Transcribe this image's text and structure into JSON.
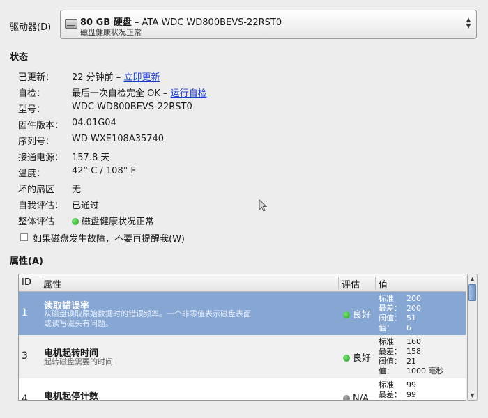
{
  "drive": {
    "label": "驱动器(D)",
    "size": "80 GB 硬盘",
    "model_suffix": " – ATA WDC WD800BEVS-22RST0",
    "subtitle": "磁盘健康状况正常"
  },
  "status": {
    "title": "状态",
    "rows": [
      {
        "key": "已更新：",
        "value": "22 分钟前 – ",
        "link": "立即更新"
      },
      {
        "key": "自检：",
        "value": "最后一次自检完全 OK – ",
        "link": "运行自检"
      },
      {
        "key": "型号：",
        "value": "WDC WD800BEVS-22RST0"
      },
      {
        "key": "固件版本：",
        "value": "04.01G04"
      },
      {
        "key": "序列号：",
        "value": "WD-WXE108A35740"
      },
      {
        "key": "接通电源：",
        "value": "157.8 天"
      },
      {
        "key": "温度：",
        "value": "42° C / 108° F"
      },
      {
        "key": "坏的扇区",
        "value": "无"
      },
      {
        "key": "自我评估：",
        "value": "已通过"
      },
      {
        "key": "整体评估",
        "value": "磁盘健康状况正常"
      }
    ]
  },
  "notify": {
    "label": "如果磁盘发生故障，不要再提醒我(W)",
    "checked": false
  },
  "attributes": {
    "title": "属性(A)",
    "columns": {
      "id": "ID",
      "name": "属性",
      "assessment": "评估",
      "value": "值"
    },
    "rows": [
      {
        "id": "1",
        "name": "读取错误率",
        "desc1": "从磁盘读取原始数据时的错误频率。一个非零值表示磁盘表面",
        "desc2": "或读写磁头有问题。",
        "assessment": "良好",
        "v_norm_key": "标准",
        "v_norm": "200",
        "v_worst_key": "最差：",
        "v_worst": "200",
        "v_thresh_key": "阀值：",
        "v_thresh": "51",
        "v_val_key": "值：",
        "v_val": "6"
      },
      {
        "id": "3",
        "name": "电机起转时间",
        "desc1": "起转磁盘需要的时间",
        "assessment": "良好",
        "v_norm_key": "标准",
        "v_norm": "160",
        "v_worst_key": "最差：",
        "v_worst": "158",
        "v_thresh_key": "阀值：",
        "v_thresh": "21",
        "v_val_key": "值：",
        "v_val": "1000 毫秒"
      },
      {
        "id": "4",
        "name": "电机起停计数",
        "assessment": "N/A",
        "v_norm_key": "标准",
        "v_norm": "99",
        "v_worst_key": "最差：",
        "v_worst": "99"
      }
    ]
  },
  "colors": {
    "selected_row": "#86a7d3",
    "good": "#1ea21a",
    "link": "#1a3dc9"
  }
}
